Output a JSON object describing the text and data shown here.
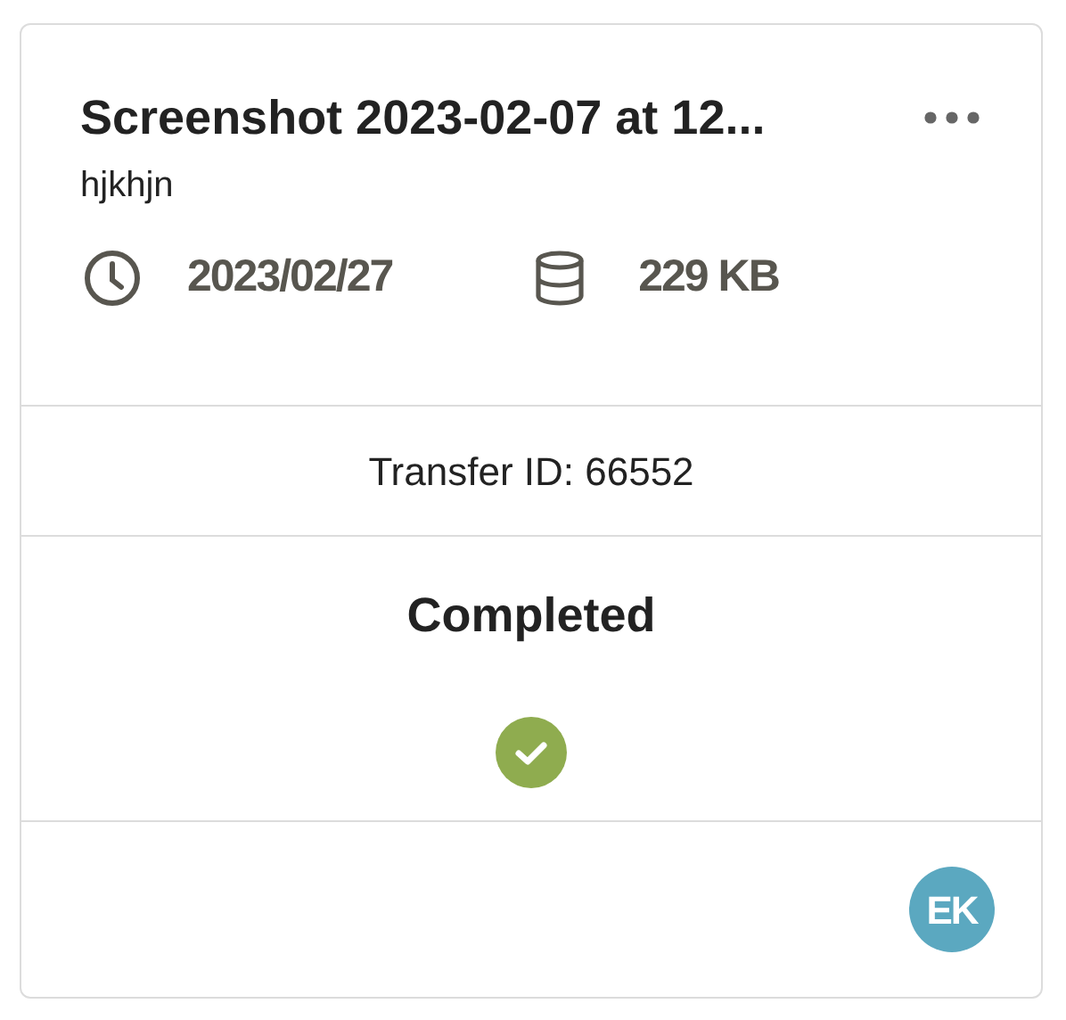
{
  "card": {
    "title": "Screenshot 2023-02-07 at 12...",
    "subtitle": "hjkhjn",
    "date": "2023/02/27",
    "size": "229 KB",
    "transfer_id": "Transfer ID: 66552",
    "status": {
      "label": "Completed",
      "kind": "completed"
    },
    "avatar": {
      "initials": "EK"
    }
  }
}
